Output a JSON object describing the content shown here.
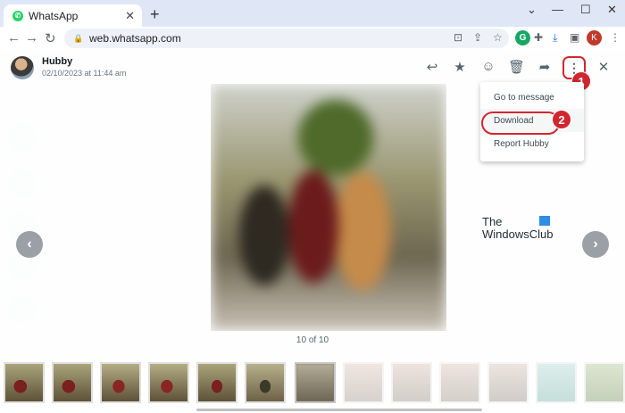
{
  "browser": {
    "tab_title": "WhatsApp",
    "tab_icon": "whatsapp-icon",
    "new_tab": "+",
    "address": "web.whatsapp.com",
    "profile_initial": "K",
    "extension_initial": "G"
  },
  "viewer": {
    "contact_name": "Hubby",
    "timestamp": "02/10/2023 at 11:44 am",
    "counter": "10 of 10",
    "header_icons": [
      "reply-icon",
      "star-icon",
      "emoji-icon",
      "delete-icon",
      "forward-icon",
      "more-options-icon",
      "close-icon"
    ],
    "menu_items": [
      "Go to message",
      "Download",
      "Report Hubby"
    ],
    "callouts": [
      "1",
      "2"
    ],
    "watermark": {
      "line1": "The",
      "line2": "WindowsClub"
    },
    "nav": {
      "prev": "‹",
      "next": "›"
    },
    "thumbnail_count": 13,
    "current_thumbnail": 7
  },
  "colors": {
    "accent_red": "#d0272f",
    "whatsapp_green": "#25d366",
    "chrome_bar": "#dfe7f7"
  }
}
